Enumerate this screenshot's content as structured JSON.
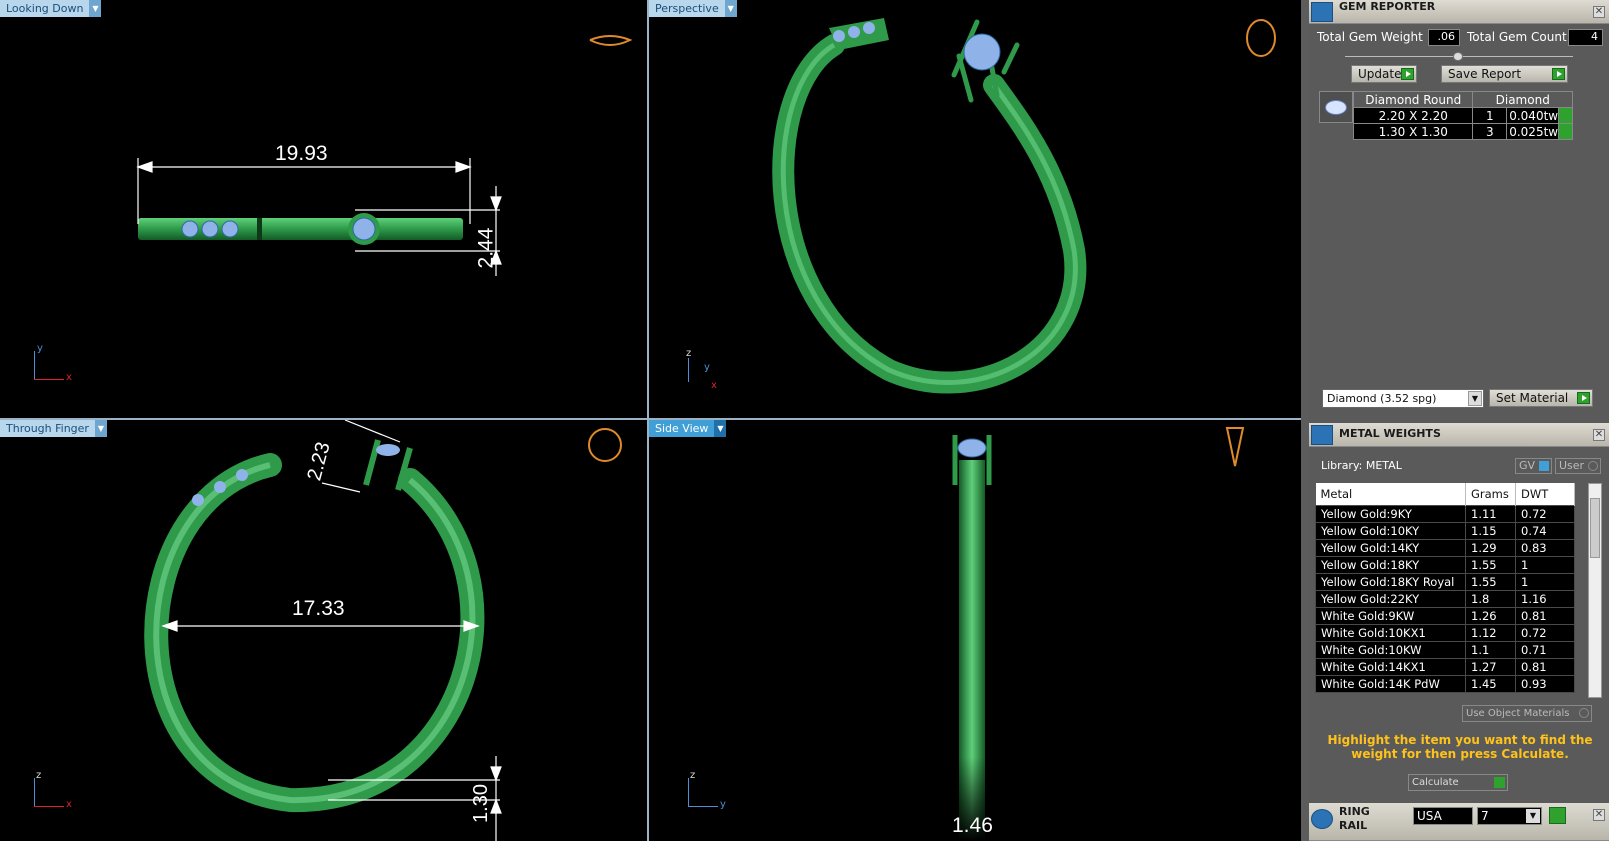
{
  "viewports": {
    "top_left": {
      "label": "Looking Down",
      "dimension_1": "19.93",
      "dimension_2": "2.44",
      "axis_v": "y",
      "axis_h": "x"
    },
    "top_right": {
      "label": "Perspective",
      "axis_v": "z",
      "axis_h": "y",
      "axis_d": "x"
    },
    "bottom_left": {
      "label": "Through Finger",
      "dimension_1": "17.33",
      "dimension_2": "2.23",
      "dimension_3": "1.30",
      "axis_v": "z",
      "axis_h": "x"
    },
    "bottom_right": {
      "label": "Side View",
      "dimension_1": "1.46",
      "axis_v": "z",
      "axis_h": "y"
    }
  },
  "gem_reporter": {
    "title": "GEM REPORTER",
    "total_weight_label": "Total Gem Weight",
    "total_weight_value": ".06",
    "total_count_label": "Total Gem Count",
    "total_count_value": "4",
    "update_label": "Update",
    "save_label": "Save Report",
    "table_header": [
      "Diamond Round",
      "Diamond"
    ],
    "rows": [
      {
        "size": "2.20 X 2.20",
        "count": "1",
        "weight": "0.040tw"
      },
      {
        "size": "1.30 X 1.30",
        "count": "3",
        "weight": "0.025tw"
      }
    ],
    "material_select": "Diamond    (3.52 spg)",
    "set_material_label": "Set Material"
  },
  "metal_weights": {
    "title": "METAL WEIGHTS",
    "library_label": "Library: METAL",
    "gv_label": "GV",
    "user_label": "User",
    "headers": [
      "Metal",
      "Grams",
      "DWT"
    ],
    "rows": [
      [
        "Yellow Gold:9KY",
        "1.11",
        "0.72"
      ],
      [
        "Yellow Gold:10KY",
        "1.15",
        "0.74"
      ],
      [
        "Yellow Gold:14KY",
        "1.29",
        "0.83"
      ],
      [
        "Yellow Gold:18KY",
        "1.55",
        "1"
      ],
      [
        "Yellow Gold:18KY Royal",
        "1.55",
        "1"
      ],
      [
        "Yellow Gold:22KY",
        "1.8",
        "1.16"
      ],
      [
        "White Gold:9KW",
        "1.26",
        "0.81"
      ],
      [
        "White Gold:10KX1",
        "1.12",
        "0.72"
      ],
      [
        "White Gold:10KW",
        "1.1",
        "0.71"
      ],
      [
        "White Gold:14KX1",
        "1.27",
        "0.81"
      ],
      [
        "White Gold:14K PdW",
        "1.45",
        "0.93"
      ]
    ],
    "use_object_materials": "Use Object Materials",
    "note": "Highlight the item you want to find the weight for then press Calculate.",
    "calculate_label": "Calculate"
  },
  "ring_rail": {
    "title": "RING RAIL",
    "region": "USA",
    "size": "7"
  },
  "colors": {
    "ring": "#2e9a4a",
    "stone": "#8fb2e8",
    "panel": "#5a5a5a",
    "note": "#ffc21a"
  }
}
